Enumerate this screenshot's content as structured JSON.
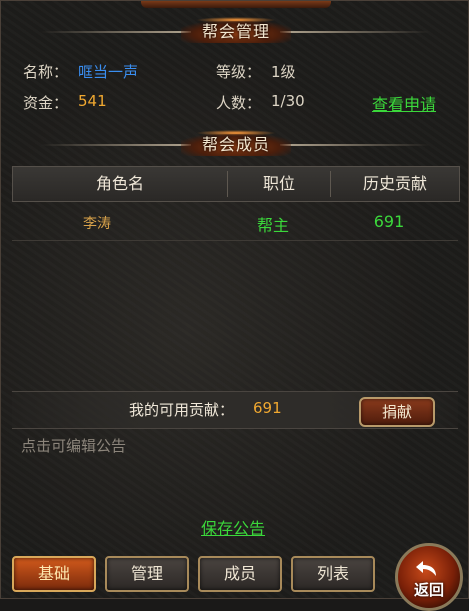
{
  "guild_management": {
    "title": "帮会管理",
    "name_label": "名称：",
    "name_value": "哐当一声",
    "level_label": "等级：",
    "level_value": "1级",
    "funds_label": "资金：",
    "funds_value": "541",
    "members_label": "人数：",
    "members_value": "1/30",
    "view_applications_label": "查看申请"
  },
  "guild_members": {
    "title": "帮会成员",
    "columns": [
      "角色名",
      "职位",
      "历史贡献"
    ],
    "rows": [
      {
        "name": "李涛",
        "position": "帮主",
        "contribution": "691"
      }
    ]
  },
  "contribution": {
    "label": "我的可用贡献：",
    "value": "691",
    "donate_label": "捐献"
  },
  "notice": {
    "placeholder": "点击可编辑公告",
    "save_label": "保存公告"
  },
  "tabs": [
    {
      "label": "基础",
      "active": true
    },
    {
      "label": "管理",
      "active": false
    },
    {
      "label": "成员",
      "active": false
    },
    {
      "label": "列表",
      "active": false
    }
  ],
  "return_button": {
    "label": "返回",
    "icon": "return-arrow-icon"
  },
  "colors": {
    "guild_name": "#3a8ef0",
    "funds": "#f0a830",
    "member_name": "#d8a24a",
    "position": "#3bd83b",
    "contribution": "#3bd83b",
    "link": "#3bd83b",
    "active_tab": "#d25a1c"
  }
}
